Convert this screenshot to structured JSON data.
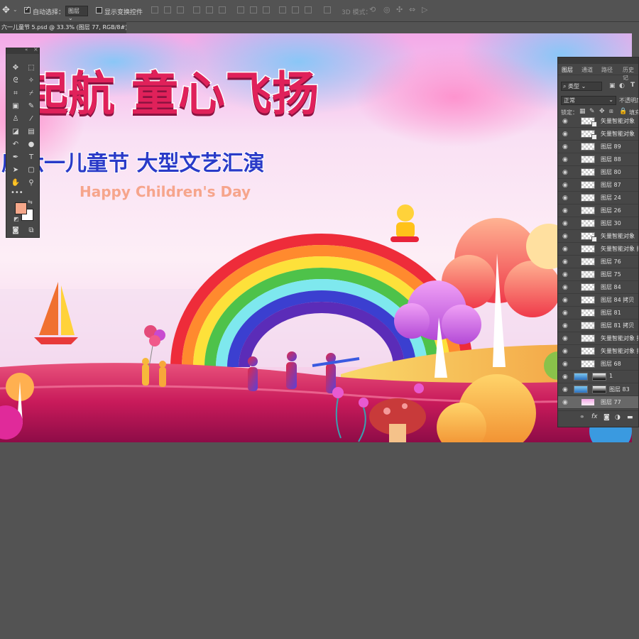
{
  "options_bar": {
    "auto_select_label": "自动选择：",
    "auto_select_checked": true,
    "auto_select_value": "图层",
    "show_transform_label": "显示变换控件",
    "mode_3d_label": "3D 模式："
  },
  "document_tab": {
    "title": "六一儿童节 5.psd @ 33.3% (图层 77, RGB/8#) *",
    "close_glyph": "×"
  },
  "canvas_artwork": {
    "title_line": "起航 童心飞扬",
    "subtitle_line": "度六一儿童节 大型文艺汇演",
    "english_line": "Happy Children's Day"
  },
  "toolbox": {
    "tools": [
      "move-tool",
      "marquee-tool",
      "lasso-tool",
      "magic-wand-tool",
      "crop-tool",
      "eyedropper-tool",
      "frame-tool",
      "healing-brush-tool",
      "stamp-tool",
      "brush-tool",
      "eraser-tool",
      "gradient-tool",
      "history-brush-tool",
      "dodge-tool",
      "pen-tool",
      "type-tool",
      "path-select-tool",
      "shape-tool",
      "hand-tool",
      "zoom-tool",
      "more-tools"
    ],
    "foreground_color": "#f5a78a",
    "background_color": "#ffffff"
  },
  "layers_panel": {
    "tabs": [
      "图层",
      "通道",
      "路径",
      "历史记"
    ],
    "filter_label": "类型",
    "blend_mode": "正常",
    "opacity_label": "不透明度",
    "lock_label": "锁定：",
    "fill_label": "填充",
    "layers": [
      {
        "name": "矢量智能对象",
        "type": "smart"
      },
      {
        "name": "矢量智能对象",
        "type": "smart"
      },
      {
        "name": "图层 89",
        "type": "pixel"
      },
      {
        "name": "图层 88",
        "type": "pixel"
      },
      {
        "name": "图层 80",
        "type": "pixel"
      },
      {
        "name": "图层 87",
        "type": "pixel"
      },
      {
        "name": "图层 24",
        "type": "pixel"
      },
      {
        "name": "图层 26",
        "type": "pixel"
      },
      {
        "name": "图层 30",
        "type": "pixel"
      },
      {
        "name": "矢量智能对象",
        "type": "smart"
      },
      {
        "name": "矢量智能对象 拷贝",
        "type": "pixel"
      },
      {
        "name": "图层 76",
        "type": "pixel"
      },
      {
        "name": "图层 75",
        "type": "pixel"
      },
      {
        "name": "图层 84",
        "type": "pixel"
      },
      {
        "name": "图层 84 拷贝",
        "type": "pixel"
      },
      {
        "name": "图层 81",
        "type": "pixel"
      },
      {
        "name": "图层 81 拷贝",
        "type": "pixel"
      },
      {
        "name": "矢量智能对象 拷贝",
        "type": "pixel"
      },
      {
        "name": "矢量智能对象 拷贝",
        "type": "pixel"
      },
      {
        "name": "图层 68",
        "type": "pixel"
      },
      {
        "name": "1",
        "type": "masked"
      },
      {
        "name": "图层 83",
        "type": "masked"
      },
      {
        "name": "图层 77",
        "type": "pixel",
        "selected": true
      }
    ],
    "footer_icons": [
      "link-icon",
      "fx-icon",
      "mask-icon",
      "adjustment-icon",
      "folder-icon"
    ]
  }
}
